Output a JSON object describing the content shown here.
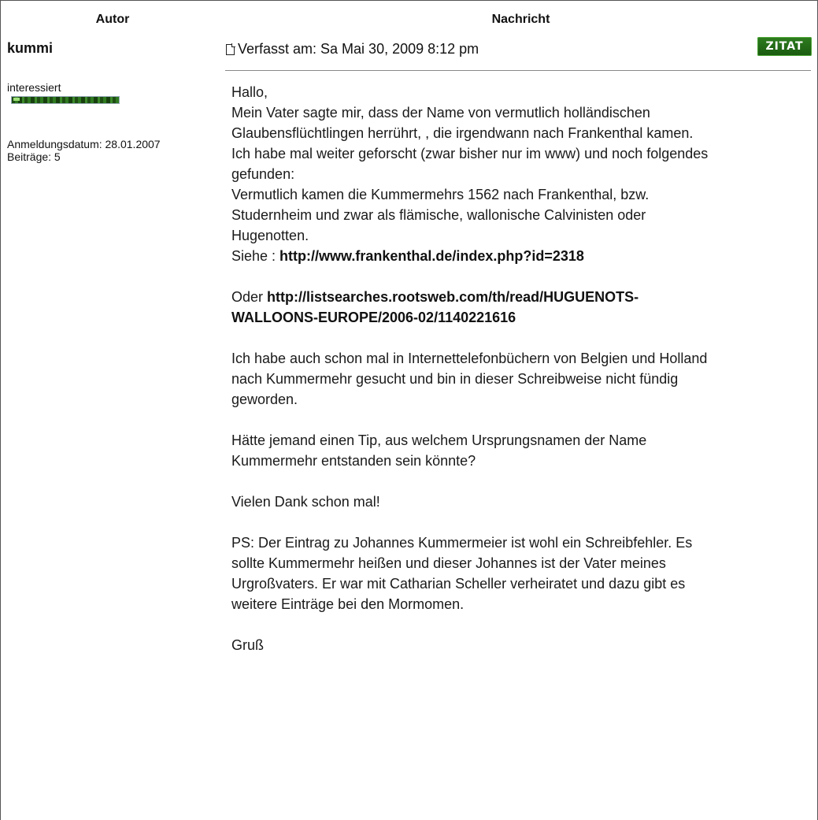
{
  "table": {
    "header_author": "Autor",
    "header_message": "Nachricht"
  },
  "author": {
    "name": "kummi",
    "rank": "interessiert",
    "registered": "Anmeldungsdatum: 28.01.2007",
    "posts": "Beiträge: 5"
  },
  "post": {
    "posted_label": "Verfasst am: Sa Mai 30, 2009 8:12 pm",
    "quote_button": "ZITAT",
    "lines": [
      "Hallo,",
      "Mein Vater sagte mir, dass der Name von vermutlich holländischen",
      "Glaubensflüchtlingen herrührt, , die irgendwann nach Frankenthal kamen.",
      "Ich habe mal weiter geforscht (zwar bisher nur im www) und noch folgendes",
      "gefunden:",
      "Vermutlich kamen die Kummermehrs 1562 nach Frankenthal, bzw.",
      "Studernheim und zwar als flämische, wallonische Calvinisten oder",
      "Hugenotten."
    ],
    "link1_prefix": "Siehe : ",
    "link1": "http://www.frankenthal.de/index.php?id=2318",
    "link2_prefix": "Oder ",
    "link2_line1": "http://listsearches.rootsweb.com/th/read/HUGUENOTS-",
    "link2_line2": "WALLOONS-EUROPE/2006-02/1140221616",
    "para_phonebook": [
      "Ich habe auch schon mal in Internettelefonbüchern von Belgien und Holland",
      "nach Kummermehr gesucht und bin in dieser Schreibweise nicht fündig",
      "geworden."
    ],
    "para_question": [
      "Hätte jemand einen Tip, aus welchem Ursprungsnamen der Name",
      "Kummermehr entstanden sein könnte?"
    ],
    "thanks": "Vielen Dank schon mal!",
    "para_ps": [
      "PS: Der Eintrag zu Johannes Kummermeier ist wohl ein Schreibfehler. Es",
      "sollte Kummermehr heißen und dieser Johannes ist der Vater meines",
      "Urgroßvaters. Er war mit Catharian Scheller verheiratet und dazu gibt es",
      "weitere Einträge bei den Mormomen."
    ],
    "greeting": "Gruß"
  }
}
